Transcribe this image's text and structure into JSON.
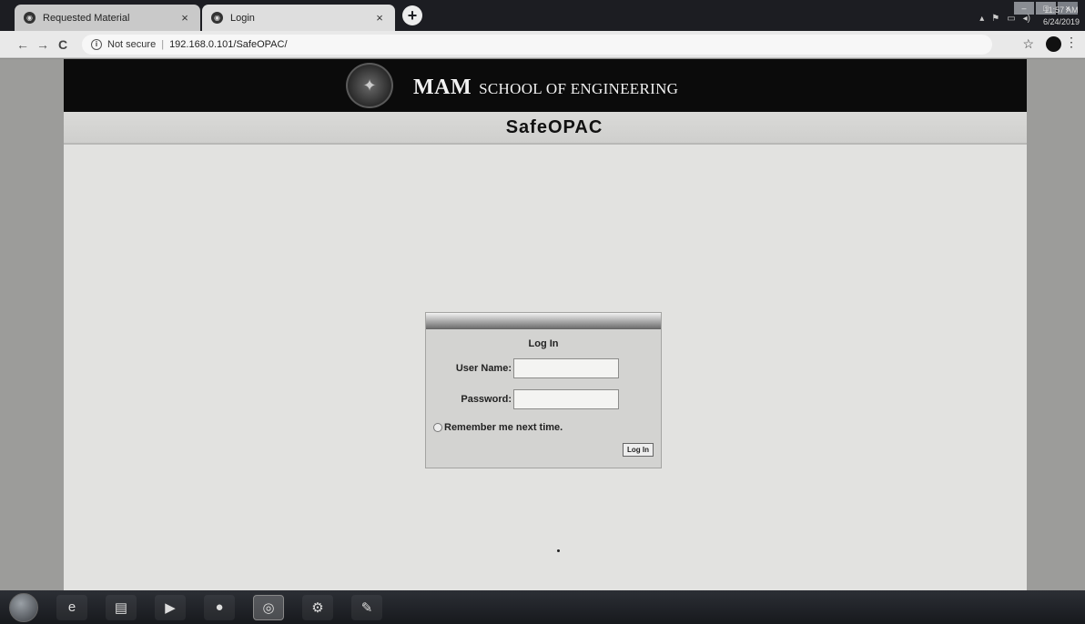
{
  "tabs": [
    {
      "title": "Requested Material",
      "active": false
    },
    {
      "title": "Login",
      "active": true
    }
  ],
  "toolbar": {
    "security": "Not secure",
    "url": "192.168.0.101/SafeOPAC/"
  },
  "site": {
    "abbr": "MAM",
    "name_rest": "SCHOOL OF ENGINEERING",
    "app_title": "SafeOPAC"
  },
  "login": {
    "title": "Log In",
    "username_label": "User Name:",
    "password_label": "Password:",
    "username_value": "",
    "password_value": "",
    "remember_label": "Remember me next time.",
    "remember_checked": false,
    "button_label": "Log In"
  },
  "clock": {
    "time": "11:57 AM",
    "date": "6/24/2019"
  }
}
